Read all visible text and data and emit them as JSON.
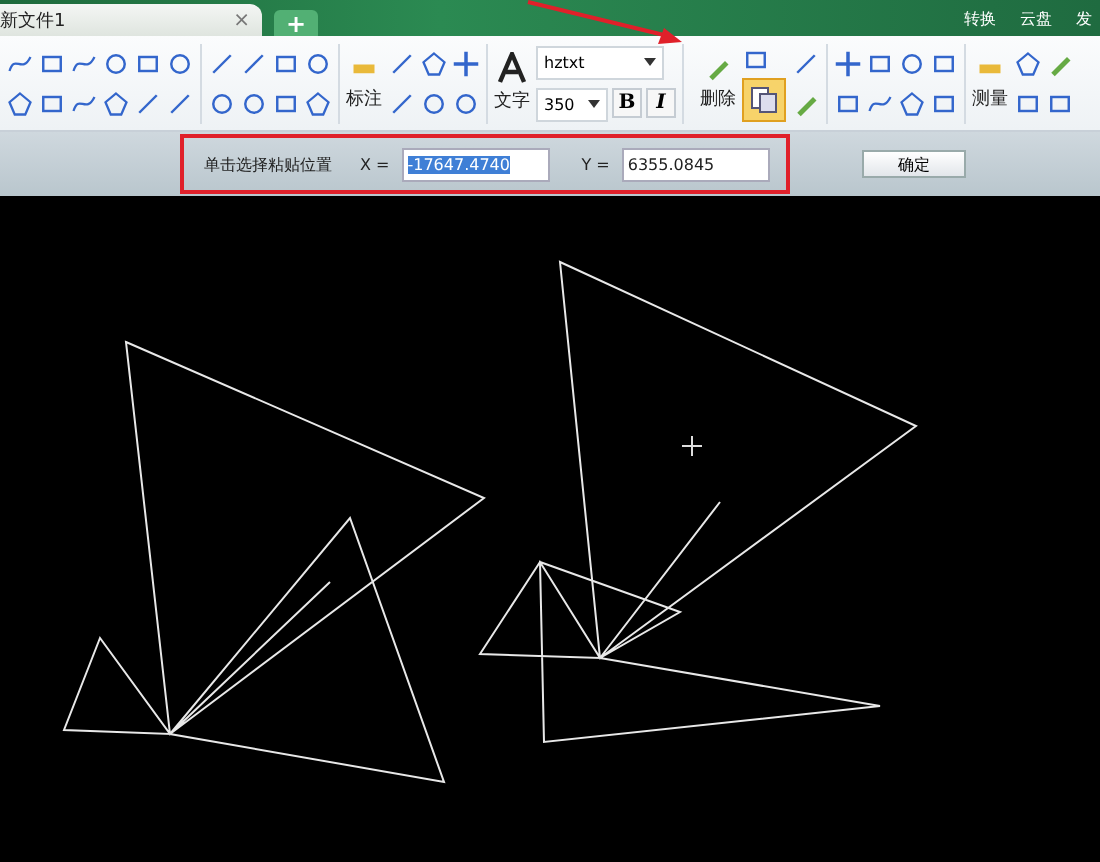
{
  "tabs": [
    {
      "label": "新文件1",
      "selected": true,
      "close": "×"
    }
  ],
  "new_tab": "+",
  "header_actions": [
    {
      "label": "转换"
    },
    {
      "label": "云盘"
    },
    {
      "label": "发"
    }
  ],
  "ribbon": {
    "dimension_label": "标注",
    "text_label": "文字",
    "font": "hztxt",
    "size": "350",
    "bold": "B",
    "italic": "I",
    "delete_label": "删除",
    "measure_label": "测量",
    "paste_active": true
  },
  "command_bar": {
    "prompt": "单击选择粘贴位置",
    "x_label": "X =",
    "x_value": "-17647.4740",
    "x_selected": true,
    "y_label": "Y =",
    "y_value": "6355.0845",
    "confirm": "确定"
  }
}
